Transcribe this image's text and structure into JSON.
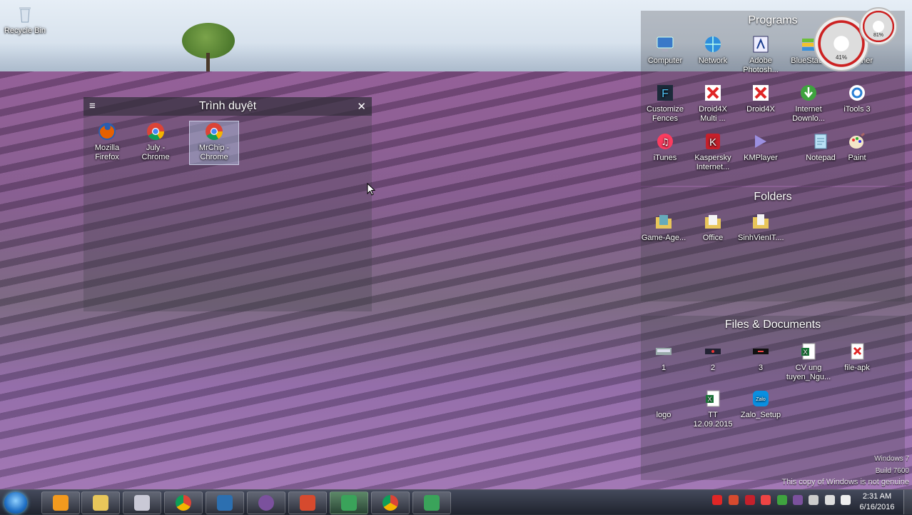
{
  "desktop": {
    "recycle_bin": "Recycle Bin"
  },
  "browser_fence": {
    "title": "Trình duyệt",
    "menu_glyph": "≡",
    "close_glyph": "✕",
    "items": [
      {
        "line1": "Mozilla",
        "line2": "Firefox",
        "icon": "firefox-icon"
      },
      {
        "line1": "July -",
        "line2": "Chrome",
        "icon": "chrome-icon"
      },
      {
        "line1": "MrChip -",
        "line2": "Chrome",
        "icon": "chrome-icon",
        "selected": true
      }
    ]
  },
  "programs_fence": {
    "title": "Programs",
    "items": [
      {
        "line1": "Computer",
        "line2": ""
      },
      {
        "line1": "Network",
        "line2": ""
      },
      {
        "line1": "Adobe",
        "line2": "Photosh..."
      },
      {
        "line1": "BlueStack",
        "line2": ""
      },
      {
        "line1": "aner",
        "line2": ""
      },
      {
        "line1": "Customize",
        "line2": "Fences"
      },
      {
        "line1": "Droid4X",
        "line2": "Multi ..."
      },
      {
        "line1": "Droid4X",
        "line2": ""
      },
      {
        "line1": "Internet",
        "line2": "Downlo..."
      },
      {
        "line1": "iTools 3",
        "line2": ""
      },
      {
        "line1": "iTunes",
        "line2": ""
      },
      {
        "line1": "Kaspersky",
        "line2": "Internet..."
      },
      {
        "line1": "KMPlayer",
        "line2": ""
      },
      {
        "line1": "Notepad",
        "line2": ""
      },
      {
        "line1": "Paint",
        "line2": ""
      }
    ]
  },
  "folders_fence": {
    "title": "Folders",
    "items": [
      {
        "line1": "Game-Age...",
        "line2": ""
      },
      {
        "line1": "Office",
        "line2": ""
      },
      {
        "line1": "SinhVienIT....",
        "line2": ""
      }
    ]
  },
  "files_fence": {
    "title": "Files & Documents",
    "items": [
      {
        "line1": "1",
        "line2": ""
      },
      {
        "line1": "2",
        "line2": ""
      },
      {
        "line1": "3",
        "line2": ""
      },
      {
        "line1": "CV ung",
        "line2": "tuyen_Ngu..."
      },
      {
        "line1": "file-apk",
        "line2": ""
      },
      {
        "line1": "logo",
        "line2": ""
      },
      {
        "line1": "TT 12.09.2015",
        "line2": ""
      },
      {
        "line1": "Zalo_Setup",
        "line2": ""
      }
    ]
  },
  "gadget": {
    "cpu": "41%",
    "mem": "81%"
  },
  "watermark": {
    "line1": "Windows 7",
    "line2": "Build 7600",
    "line3": "This copy of Windows is not genuine"
  },
  "clock": {
    "time": "2:31 AM",
    "date": "6/16/2016"
  },
  "colors": {
    "chrome_red": "#db4437",
    "chrome_green": "#0f9d58",
    "chrome_yellow": "#f4b400",
    "firefox_orange": "#e66000",
    "droid_red": "#e02626"
  }
}
